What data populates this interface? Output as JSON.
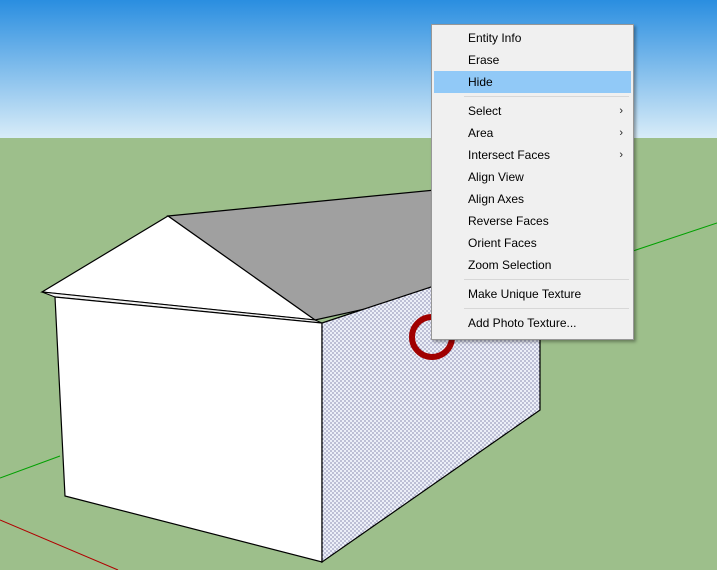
{
  "scene": {
    "colors": {
      "sky_top": "#2a8ee0",
      "sky_bottom": "#d8ecf8",
      "ground": "#9dbf8b",
      "roof_gray": "#a0a0a0",
      "wall_white": "#ffffff",
      "texture_face": "#eceff8",
      "texture_dots": "#5a5a8c",
      "highlight_circle": "#a00000",
      "axis_green": "#00a000",
      "axis_red": "#b00000"
    }
  },
  "context_menu": {
    "items": [
      {
        "label": "Entity Info"
      },
      {
        "label": "Erase"
      },
      {
        "label": "Hide",
        "highlighted": true
      },
      {
        "label": "Select",
        "submenu": true
      },
      {
        "label": "Area",
        "submenu": true
      },
      {
        "label": "Intersect Faces",
        "submenu": true
      },
      {
        "label": "Align View"
      },
      {
        "label": "Align Axes"
      },
      {
        "label": "Reverse Faces"
      },
      {
        "label": "Orient Faces"
      },
      {
        "label": "Zoom Selection"
      },
      {
        "label": "Make Unique Texture"
      },
      {
        "label": "Add Photo Texture..."
      }
    ],
    "submenu_arrow": "›"
  }
}
